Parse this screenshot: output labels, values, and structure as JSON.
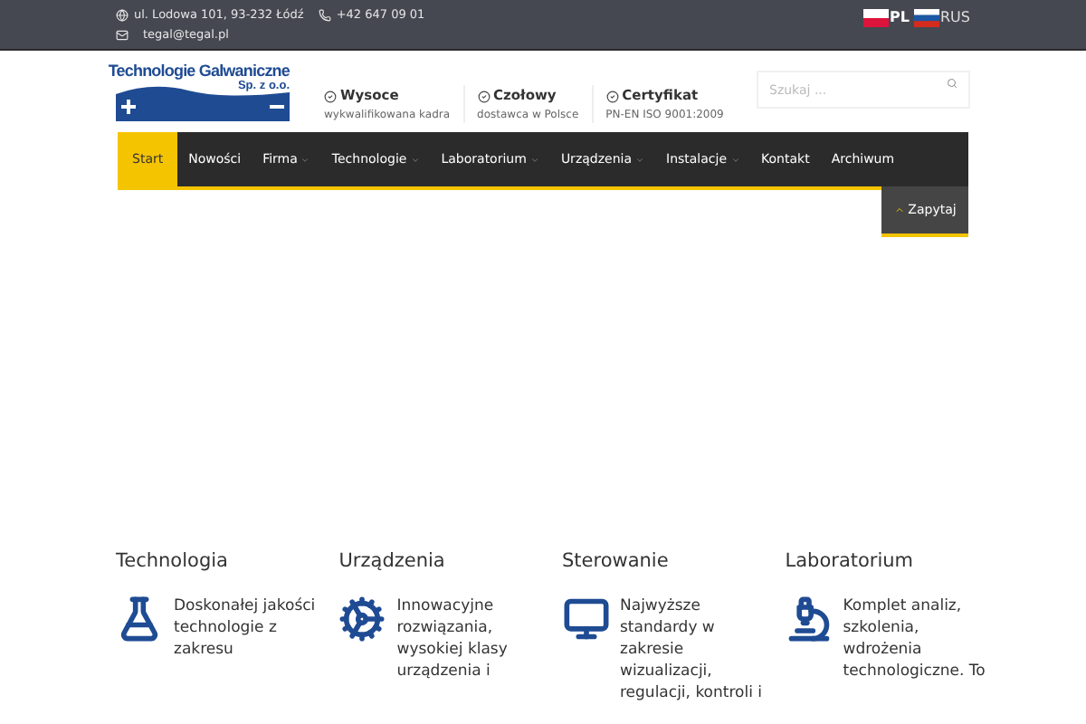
{
  "top_bar": {
    "address": "ul. Lodowa 101, 93-232 Łódź",
    "phone": "+42 647 09 01",
    "email": "tegal@tegal.pl",
    "languages": [
      {
        "code": "PL",
        "selected": true
      },
      {
        "code": "RUS",
        "selected": false
      }
    ]
  },
  "logo": {
    "name": "Technologie Galwaniczne",
    "suffix": "Sp. z o.o."
  },
  "features": [
    {
      "title": "Wysoce",
      "subtitle": "wykwalifikowana kadra"
    },
    {
      "title": "Czołowy",
      "subtitle": "dostawca w Polsce"
    },
    {
      "title": "Certyfikat",
      "subtitle": "PN-EN ISO 9001:2009"
    }
  ],
  "search": {
    "placeholder": "Szukaj ..."
  },
  "nav": [
    {
      "label": "Start",
      "selected": true,
      "has_submenu": false
    },
    {
      "label": "Nowości",
      "selected": false,
      "has_submenu": false
    },
    {
      "label": "Firma",
      "selected": false,
      "has_submenu": true
    },
    {
      "label": "Technologie",
      "selected": false,
      "has_submenu": true
    },
    {
      "label": "Laboratorium",
      "selected": false,
      "has_submenu": true
    },
    {
      "label": "Urządzenia",
      "selected": false,
      "has_submenu": true
    },
    {
      "label": "Instalacje",
      "selected": false,
      "has_submenu": true
    },
    {
      "label": "Kontakt",
      "selected": false,
      "has_submenu": false
    },
    {
      "label": "Archiwum",
      "selected": false,
      "has_submenu": false
    }
  ],
  "ask_button": {
    "label": "Zapytaj"
  },
  "sections": [
    {
      "kind": "flask",
      "title": "Technologia",
      "text": "Doskonałej jakości technologie z zakresu"
    },
    {
      "kind": "gear",
      "title": "Urządzenia",
      "text": "Innowacyjne rozwiązania, wysokiej klasy urządzenia i"
    },
    {
      "kind": "monitor",
      "title": "Sterowanie",
      "text": "Najwyższe standardy w zakresie wizualizacji, regulacji, kontroli i"
    },
    {
      "kind": "microscope",
      "title": "Laboratorium",
      "text": "Komplet analiz, szkolenia, wdrożenia technologiczne. To"
    }
  ]
}
